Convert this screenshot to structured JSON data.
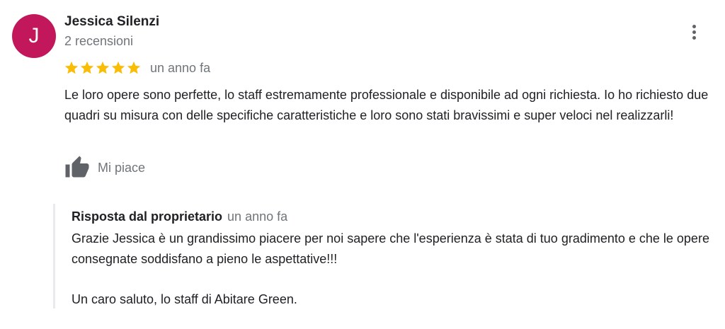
{
  "review": {
    "avatar_letter": "J",
    "avatar_color": "#c2185b",
    "author_name": "Jessica Silenzi",
    "review_count": "2 recensioni",
    "rating": 5,
    "rating_max": 5,
    "star_color": "#fbbc04",
    "date": "un anno fa",
    "text": "Le loro opere sono perfette, lo staff estremamente professionale e disponibile ad ogni richiesta. Io ho richiesto due quadri su misura con delle specifiche caratteristiche e loro sono stati bravissimi e super veloci nel realizzarli!",
    "like_label": "Mi piace",
    "more_icon": "more-vert-icon",
    "like_icon": "thumb-up-icon"
  },
  "owner_response": {
    "title": "Risposta dal proprietario",
    "date": "un anno fa",
    "text": "Grazie Jessica è un grandissimo piacere per noi sapere che l'esperienza è stata di tuo gradimento e che le opere consegnate soddisfano a pieno le aspettative!!!",
    "signoff": "Un caro saluto, lo staff di Abitare Green."
  }
}
